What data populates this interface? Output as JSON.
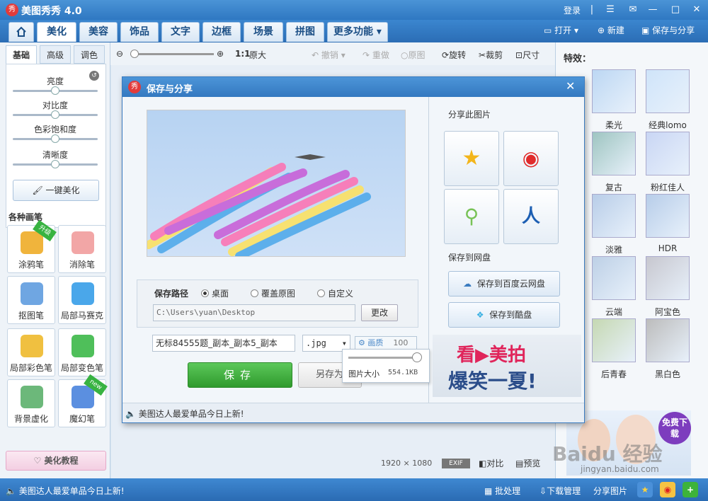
{
  "app": {
    "logo_text": "秀",
    "title": "美图秀秀 4.0",
    "login": "登录"
  },
  "window_buttons": [
    "☰",
    "✉",
    "▢",
    "—",
    "□",
    "✕"
  ],
  "tabs": [
    "美化",
    "美容",
    "饰品",
    "文字",
    "边框",
    "场景",
    "拼图",
    "更多功能 ▾"
  ],
  "top_actions": {
    "open": "打开",
    "new": "新建",
    "save_share": "保存与分享"
  },
  "toolbar": {
    "ratio": "1:1",
    "original_size": "原大",
    "undo": "撤销",
    "redo": "重做",
    "original": "原图",
    "rotate": "旋转",
    "crop": "裁剪",
    "size": "尺寸"
  },
  "left": {
    "subtabs": [
      "基础",
      "高级",
      "调色"
    ],
    "sliders": [
      {
        "label": "亮度",
        "value": 0.5
      },
      {
        "label": "对比度",
        "value": 0.5
      },
      {
        "label": "色彩饱和度",
        "value": 0.5
      },
      {
        "label": "清晰度",
        "value": 0.5
      }
    ],
    "one_key": "一键美化",
    "brushes_title": "各种画笔",
    "brushes": [
      {
        "label": "涂鸦笔",
        "badge": "升级",
        "color": "#f0b43c"
      },
      {
        "label": "消除笔",
        "badge": "",
        "color": "#f2a6a6"
      },
      {
        "label": "抠图笔",
        "badge": "",
        "color": "#6fa6e2"
      },
      {
        "label": "局部马赛克",
        "badge": "",
        "color": "#4aa7ea"
      },
      {
        "label": "局部彩色笔",
        "badge": "",
        "color": "#f0c040"
      },
      {
        "label": "局部变色笔",
        "badge": "",
        "color": "#4fbf5a"
      },
      {
        "label": "背景虚化",
        "badge": "",
        "color": "#6cb87a"
      },
      {
        "label": "魔幻笔",
        "badge": "new",
        "color": "#5b8fe0"
      }
    ],
    "tutorial": "美化教程"
  },
  "canvas": {
    "dims_w": "1920",
    "dims_x": "×",
    "dims_h": "1080",
    "exif": "EXIF",
    "compare": "对比",
    "preview": "预览"
  },
  "right": {
    "title": "特效：",
    "effects": [
      "柔光",
      "经典lomo",
      "复古",
      "粉红佳人",
      "淡雅",
      "HDR",
      "云端",
      "阿宝色",
      "后青春",
      "黑白色"
    ],
    "ad_btn": "免费下载",
    "watermark": "Baidu 经验",
    "watermark_url": "jingyan.baidu.com"
  },
  "dialog": {
    "title": "保存与分享",
    "share_title": "分享此图片",
    "cloud_title": "保存到网盘",
    "baidu_cloud": "保存到百度云网盘",
    "kupan": "保存到酷盘",
    "path_label": "保存路径",
    "path_options": [
      "桌面",
      "覆盖原图",
      "自定义"
    ],
    "path_value": "C:\\Users\\yuan\\Desktop",
    "change": "更改",
    "filename": "无标84555题_副本_副本5_副本",
    "format": ".jpg",
    "quality_label": "画质",
    "quality_value": "100",
    "size_label": "图片大小",
    "size_value": "554.1KB",
    "save": "保存",
    "save_as": "另存为",
    "footer": "美图达人最爱单品今日上新!",
    "ad_line1": "看▶美拍",
    "ad_line2": "爆笑一夏!"
  },
  "status": {
    "news": "美图达人最爱单品今日上新!",
    "batch": "批处理",
    "download": "下载管理",
    "share_pic": "分享图片"
  }
}
